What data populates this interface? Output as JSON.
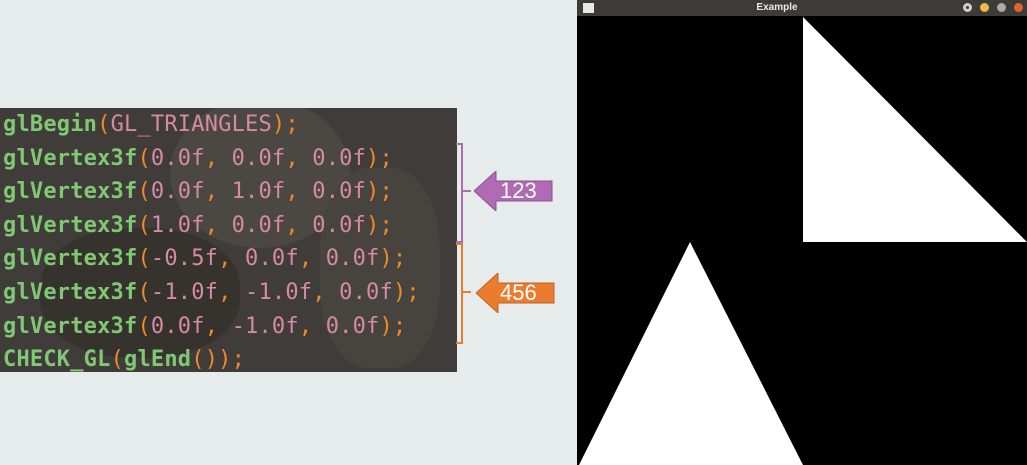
{
  "code": {
    "lines": [
      [
        {
          "t": "glBegin",
          "c": "fn"
        },
        {
          "t": "(",
          "c": "pn"
        },
        {
          "t": "GL_TRIANGLES",
          "c": "ar"
        },
        {
          "t": ");",
          "c": "pn"
        }
      ],
      [
        {
          "t": "glVertex3f",
          "c": "fn"
        },
        {
          "t": "(",
          "c": "pn"
        },
        {
          "t": "0.0f",
          "c": "ar"
        },
        {
          "t": ", ",
          "c": "pn"
        },
        {
          "t": "0.0f",
          "c": "ar"
        },
        {
          "t": ", ",
          "c": "pn"
        },
        {
          "t": "0.0f",
          "c": "ar"
        },
        {
          "t": ");",
          "c": "pn"
        }
      ],
      [
        {
          "t": "glVertex3f",
          "c": "fn"
        },
        {
          "t": "(",
          "c": "pn"
        },
        {
          "t": "0.0f",
          "c": "ar"
        },
        {
          "t": ", ",
          "c": "pn"
        },
        {
          "t": "1.0f",
          "c": "ar"
        },
        {
          "t": ", ",
          "c": "pn"
        },
        {
          "t": "0.0f",
          "c": "ar"
        },
        {
          "t": ");",
          "c": "pn"
        }
      ],
      [
        {
          "t": "glVertex3f",
          "c": "fn"
        },
        {
          "t": "(",
          "c": "pn"
        },
        {
          "t": "1.0f",
          "c": "ar"
        },
        {
          "t": ", ",
          "c": "pn"
        },
        {
          "t": "0.0f",
          "c": "ar"
        },
        {
          "t": ", ",
          "c": "pn"
        },
        {
          "t": "0.0f",
          "c": "ar"
        },
        {
          "t": ");",
          "c": "pn"
        }
      ],
      [
        {
          "t": "glVertex3f",
          "c": "fn"
        },
        {
          "t": "(",
          "c": "pn"
        },
        {
          "t": "-0.5f",
          "c": "ar"
        },
        {
          "t": ", ",
          "c": "pn"
        },
        {
          "t": "0.0f",
          "c": "ar"
        },
        {
          "t": ", ",
          "c": "pn"
        },
        {
          "t": "0.0f",
          "c": "ar"
        },
        {
          "t": ");",
          "c": "pn"
        }
      ],
      [
        {
          "t": "glVertex3f",
          "c": "fn"
        },
        {
          "t": "(",
          "c": "pn"
        },
        {
          "t": "-1.0f",
          "c": "ar"
        },
        {
          "t": ", ",
          "c": "pn"
        },
        {
          "t": "-1.0f",
          "c": "ar"
        },
        {
          "t": ", ",
          "c": "pn"
        },
        {
          "t": "0.0f",
          "c": "ar"
        },
        {
          "t": ");",
          "c": "pn"
        }
      ],
      [
        {
          "t": "glVertex3f",
          "c": "fn"
        },
        {
          "t": "(",
          "c": "pn"
        },
        {
          "t": "0.0f",
          "c": "ar"
        },
        {
          "t": ", ",
          "c": "pn"
        },
        {
          "t": "-1.0f",
          "c": "ar"
        },
        {
          "t": ", ",
          "c": "pn"
        },
        {
          "t": "0.0f",
          "c": "ar"
        },
        {
          "t": ");",
          "c": "pn"
        }
      ],
      [
        {
          "t": "CHECK_GL",
          "c": "fn"
        },
        {
          "t": "(",
          "c": "pn"
        },
        {
          "t": "glEnd",
          "c": "fn"
        },
        {
          "t": "());",
          "c": "pn"
        }
      ]
    ]
  },
  "annotations": {
    "group1": {
      "label": "123",
      "color": "#b16bb5"
    },
    "group2": {
      "label": "456",
      "color": "#ea7c30"
    }
  },
  "window": {
    "title": "Example",
    "menu_icon": "window-menu-icon",
    "controls": [
      "pin-icon",
      "minimize-icon",
      "maximize-icon",
      "close-icon"
    ],
    "background": "#000000",
    "fill": "#ffffff"
  }
}
